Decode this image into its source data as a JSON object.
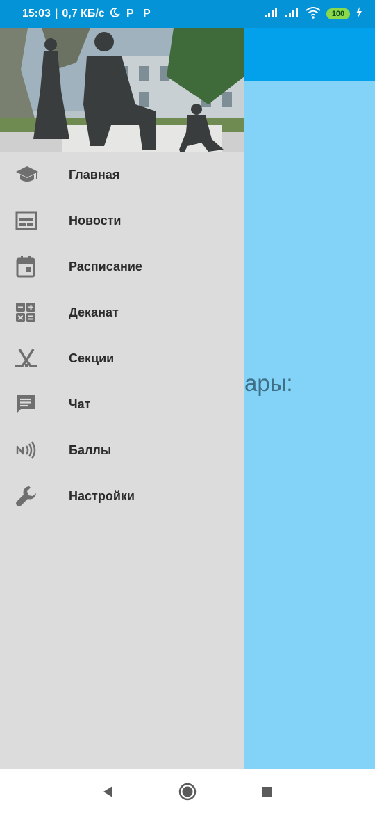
{
  "status_bar": {
    "time": "15:03",
    "net_speed": "0,7 КБ/с",
    "battery": "100"
  },
  "main": {
    "partial_text": "ары:"
  },
  "drawer": {
    "menu": [
      {
        "label": "Главная",
        "icon": "school-icon"
      },
      {
        "label": "Новости",
        "icon": "news-icon"
      },
      {
        "label": "Расписание",
        "icon": "calendar-icon"
      },
      {
        "label": "Деканат",
        "icon": "calculator-icon"
      },
      {
        "label": "Секции",
        "icon": "hockey-icon"
      },
      {
        "label": "Чат",
        "icon": "chat-icon"
      },
      {
        "label": "Баллы",
        "icon": "nfc-icon"
      },
      {
        "label": "Настройки",
        "icon": "wrench-icon"
      }
    ]
  },
  "colors": {
    "status_bar": "#0393d6",
    "app_bar": "#03a0ec",
    "content_bg": "#83d3f8",
    "drawer_bg": "#dcdcdc",
    "icon": "#6f6f6f"
  }
}
